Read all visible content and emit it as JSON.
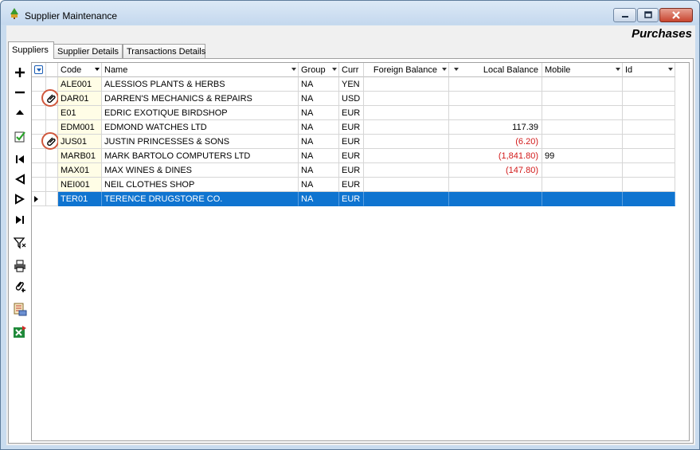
{
  "window": {
    "title": "Supplier Maintenance",
    "module": "Purchases"
  },
  "tabs": [
    "Suppliers",
    "Supplier Details",
    "Transactions Details"
  ],
  "toolbar": [
    "add-icon",
    "remove-icon",
    "up-icon",
    "edit-check-icon",
    "first-icon",
    "prev-icon",
    "next-icon",
    "last-icon",
    "filter-icon",
    "print-icon",
    "attach-add-icon",
    "report-icon",
    "export-excel-icon"
  ],
  "grid": {
    "columns": [
      "Code",
      "Name",
      "Group",
      "Curr",
      "Foreign Balance",
      "Local Balance",
      "Mobile",
      "Id"
    ],
    "rows": [
      {
        "attach": false,
        "code": "ALE001",
        "name": "ALESSIOS PLANTS & HERBS",
        "group": "NA",
        "curr": "YEN",
        "foreign": "",
        "local": "",
        "local_neg": false,
        "mobile": "",
        "id": ""
      },
      {
        "attach": true,
        "code": "DAR01",
        "name": "DARREN'S MECHANICS & REPAIRS",
        "group": "NA",
        "curr": "USD",
        "foreign": "",
        "local": "",
        "local_neg": false,
        "mobile": "",
        "id": ""
      },
      {
        "attach": false,
        "code": "E01",
        "name": "EDRIC EXOTIQUE BIRDSHOP",
        "group": "NA",
        "curr": "EUR",
        "foreign": "",
        "local": "",
        "local_neg": false,
        "mobile": "",
        "id": ""
      },
      {
        "attach": false,
        "code": "EDM001",
        "name": "EDMOND WATCHES LTD",
        "group": "NA",
        "curr": "EUR",
        "foreign": "",
        "local": "117.39",
        "local_neg": false,
        "mobile": "",
        "id": ""
      },
      {
        "attach": true,
        "code": "JUS01",
        "name": "JUSTIN PRINCESSES & SONS",
        "group": "NA",
        "curr": "EUR",
        "foreign": "",
        "local": "(6.20)",
        "local_neg": true,
        "mobile": "",
        "id": ""
      },
      {
        "attach": false,
        "code": "MARB01",
        "name": "MARK BARTOLO COMPUTERS LTD",
        "group": "NA",
        "curr": "EUR",
        "foreign": "",
        "local": "(1,841.80)",
        "local_neg": true,
        "mobile": "99",
        "id": ""
      },
      {
        "attach": false,
        "code": "MAX01",
        "name": "MAX WINES & DINES",
        "group": "NA",
        "curr": "EUR",
        "foreign": "",
        "local": "(147.80)",
        "local_neg": true,
        "mobile": "",
        "id": ""
      },
      {
        "attach": false,
        "code": "NEI001",
        "name": "NEIL CLOTHES SHOP",
        "group": "NA",
        "curr": "EUR",
        "foreign": "",
        "local": "",
        "local_neg": false,
        "mobile": "",
        "id": ""
      },
      {
        "attach": false,
        "code": "TER01",
        "name": "TERENCE DRUGSTORE CO.",
        "group": "NA",
        "curr": "EUR",
        "foreign": "",
        "local": "",
        "local_neg": false,
        "mobile": "",
        "id": "",
        "selected": true
      }
    ]
  },
  "colors": {
    "selection": "#0f74d0",
    "negative": "#d21a1a",
    "code_bg": "#fffde6",
    "attach_ring": "#d0583d"
  }
}
